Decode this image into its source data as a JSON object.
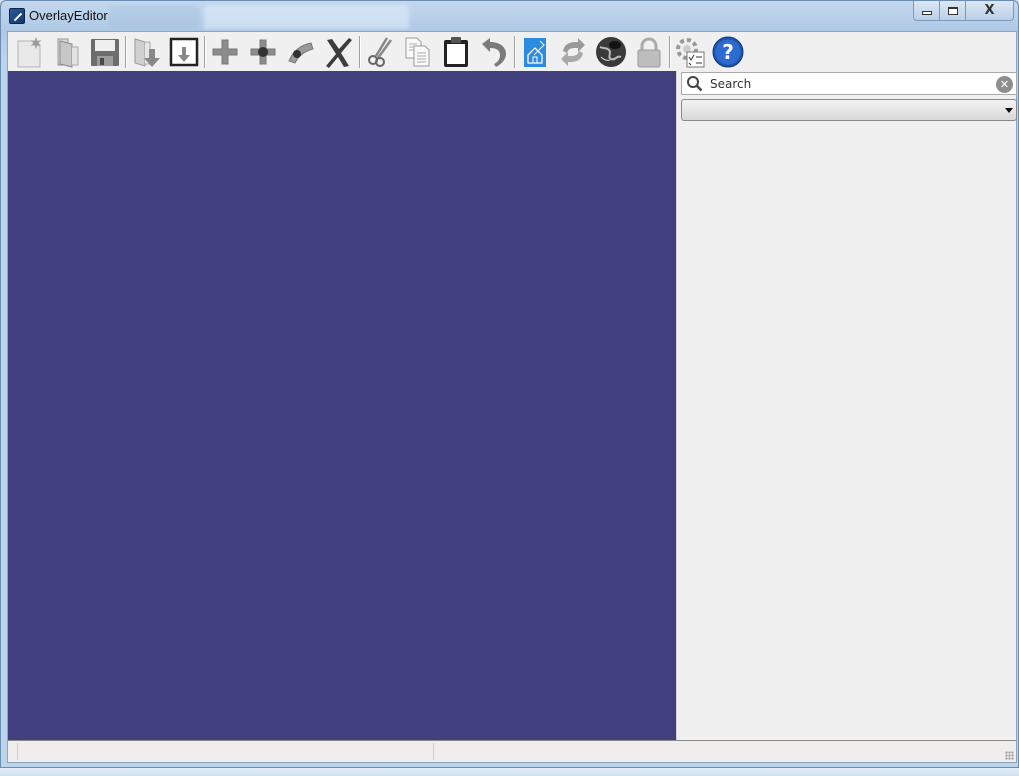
{
  "window": {
    "title": "OverlayEditor",
    "controls": {
      "minimize": "minimize",
      "maximize": "maximize",
      "close": "X"
    }
  },
  "toolbar": {
    "groups": [
      [
        {
          "name": "new-icon",
          "tooltip": "New"
        },
        {
          "name": "open-icon",
          "tooltip": "Open"
        },
        {
          "name": "save-icon",
          "tooltip": "Save"
        }
      ],
      [
        {
          "name": "import-icon",
          "tooltip": "Import"
        },
        {
          "name": "export-icon",
          "tooltip": "Export"
        }
      ],
      [
        {
          "name": "add-icon",
          "tooltip": "Add"
        },
        {
          "name": "add-node-icon",
          "tooltip": "Add node"
        },
        {
          "name": "bezier-icon",
          "tooltip": "Bezier"
        },
        {
          "name": "delete-icon",
          "tooltip": "Delete"
        }
      ],
      [
        {
          "name": "cut-icon",
          "tooltip": "Cut"
        },
        {
          "name": "copy-icon",
          "tooltip": "Copy"
        },
        {
          "name": "paste-icon",
          "tooltip": "Paste"
        },
        {
          "name": "undo-icon",
          "tooltip": "Undo"
        }
      ],
      [
        {
          "name": "home-icon",
          "tooltip": "Home"
        },
        {
          "name": "refresh-icon",
          "tooltip": "Refresh"
        },
        {
          "name": "imagery-icon",
          "tooltip": "Imagery"
        },
        {
          "name": "lock-icon",
          "tooltip": "Lock"
        }
      ],
      [
        {
          "name": "preferences-icon",
          "tooltip": "Preferences"
        },
        {
          "name": "help-icon",
          "tooltip": "Help"
        }
      ]
    ]
  },
  "sidebar": {
    "search": {
      "placeholder": "Search",
      "value": ""
    },
    "filter_select": {
      "selected": ""
    }
  },
  "statusbar": {
    "segments": [
      "",
      "",
      ""
    ]
  },
  "colors": {
    "canvas": "#413f7d",
    "panel": "#f0f0f0"
  }
}
